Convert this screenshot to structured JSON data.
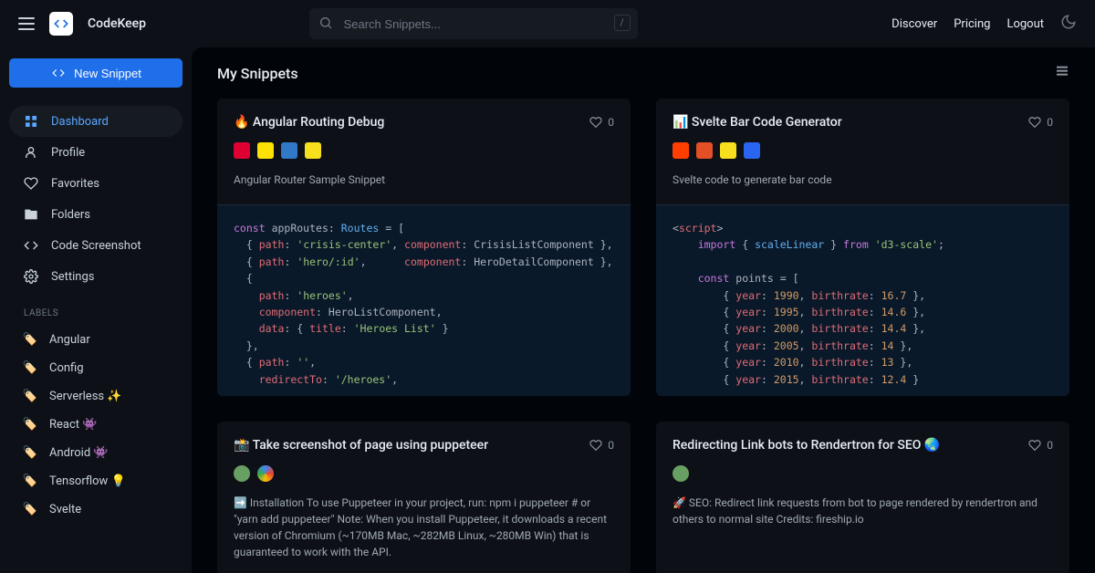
{
  "brand": "CodeKeep",
  "search": {
    "placeholder": "Search Snippets...",
    "kbd": "/"
  },
  "nav": {
    "discover": "Discover",
    "pricing": "Pricing",
    "logout": "Logout"
  },
  "newSnippet": "New Snippet",
  "sidebar": {
    "items": [
      {
        "label": "Dashboard"
      },
      {
        "label": "Profile"
      },
      {
        "label": "Favorites"
      },
      {
        "label": "Folders"
      },
      {
        "label": "Code Screenshot"
      },
      {
        "label": "Settings"
      }
    ]
  },
  "labelsHeader": "LABELS",
  "labels": [
    {
      "label": "Angular"
    },
    {
      "label": "Config"
    },
    {
      "label": "Serverless ✨"
    },
    {
      "label": "React 👾"
    },
    {
      "label": "Android 👾"
    },
    {
      "label": "Tensorflow 💡"
    },
    {
      "label": "Svelte"
    }
  ],
  "mainTitle": "My Snippets",
  "cards": [
    {
      "title": "🔥 Angular Routing Debug",
      "likes": "0",
      "desc": "Angular Router Sample Snippet"
    },
    {
      "title": "📊 Svelte Bar Code Generator",
      "likes": "0",
      "desc": "Svelte code to generate bar code"
    },
    {
      "title": "📸 Take screenshot of page using puppeteer",
      "likes": "0",
      "desc": "➡️ Installation To use Puppeteer in your project, run: npm i puppeteer # or \"yarn add puppeteer\" Note: When you install Puppeteer, it downloads a recent version of Chromium (~170MB Mac, ~282MB Linux, ~280MB Win) that is guaranteed to work with the API."
    },
    {
      "title": "Redirecting Link bots to Rendertron for SEO 🌏",
      "likes": "0",
      "desc": "🚀 SEO: Redirect link requests from bot to page rendered by rendertron and others to normal site Credits: fireship.io"
    }
  ]
}
